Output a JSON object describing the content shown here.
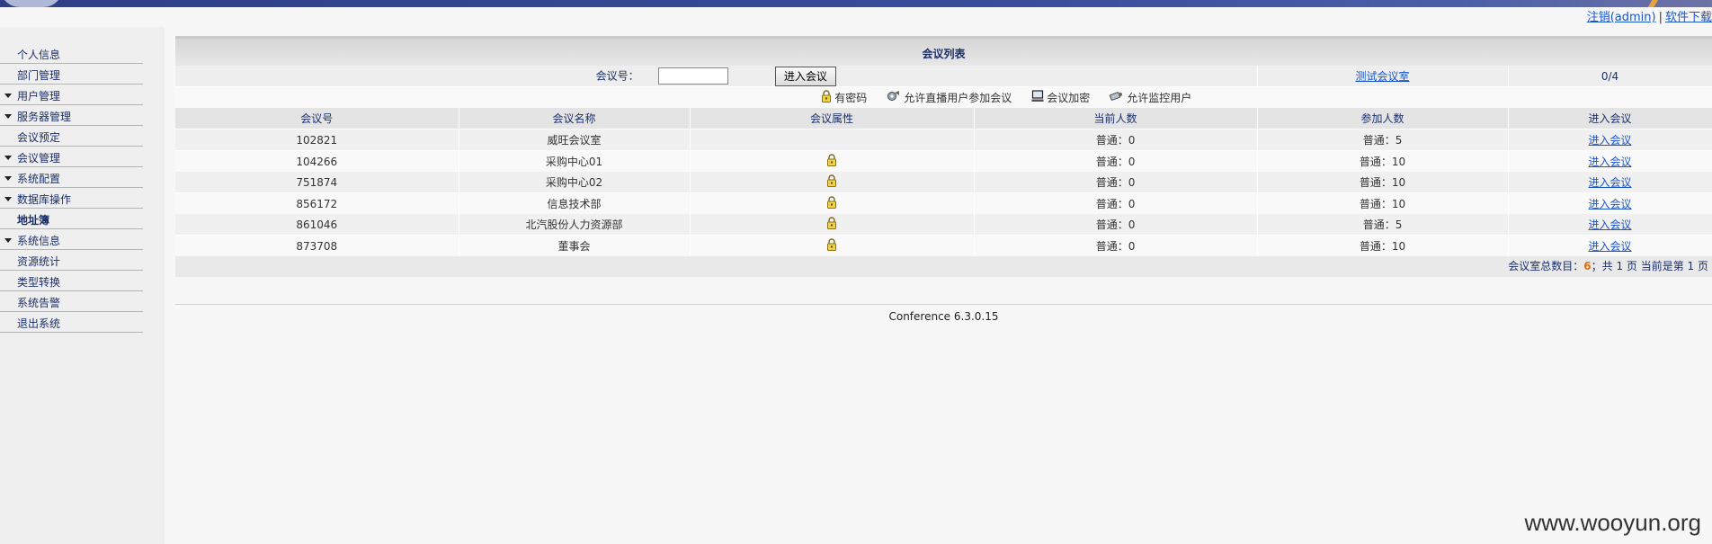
{
  "topbar": {
    "logout_label": "注销(admin)",
    "separator": "|",
    "download_label": "软件下载"
  },
  "sidebar": {
    "items": [
      {
        "label": "个人信息",
        "expandable": false
      },
      {
        "label": "部门管理",
        "expandable": false
      },
      {
        "label": "用户管理",
        "expandable": true
      },
      {
        "label": "服务器管理",
        "expandable": true
      },
      {
        "label": "会议预定",
        "expandable": false
      },
      {
        "label": "会议管理",
        "expandable": true
      },
      {
        "label": "系统配置",
        "expandable": true
      },
      {
        "label": "数据库操作",
        "expandable": true
      },
      {
        "label": "地址簿",
        "expandable": false
      },
      {
        "label": "系统信息",
        "expandable": true
      },
      {
        "label": "资源统计",
        "expandable": false
      },
      {
        "label": "类型转换",
        "expandable": false
      },
      {
        "label": "系统告警",
        "expandable": false
      },
      {
        "label": "退出系统",
        "expandable": false
      }
    ]
  },
  "main": {
    "title": "会议列表",
    "search": {
      "label": "会议号：",
      "value": "",
      "button": "进入会议",
      "test_room_link": "测试会议室",
      "online_count": "0/4"
    },
    "legend": [
      {
        "icon": "lock-icon",
        "label": "有密码"
      },
      {
        "icon": "broadcast-icon",
        "label": "允许直播用户参加会议"
      },
      {
        "icon": "computer-icon",
        "label": "会议加密"
      },
      {
        "icon": "monitor-camera-icon",
        "label": "允许监控用户"
      }
    ],
    "columns": [
      "会议号",
      "会议名称",
      "会议属性",
      "当前人数",
      "参加人数",
      "进入会议"
    ],
    "rows": [
      {
        "id": "102821",
        "name": "威旺会议室",
        "locked": false,
        "current": "普通：0",
        "capacity": "普通：5",
        "enter": "进入会议"
      },
      {
        "id": "104266",
        "name": "采购中心01",
        "locked": true,
        "current": "普通：0",
        "capacity": "普通：10",
        "enter": "进入会议"
      },
      {
        "id": "751874",
        "name": "采购中心02",
        "locked": true,
        "current": "普通：0",
        "capacity": "普通：10",
        "enter": "进入会议"
      },
      {
        "id": "856172",
        "name": "信息技术部",
        "locked": true,
        "current": "普通：0",
        "capacity": "普通：10",
        "enter": "进入会议"
      },
      {
        "id": "861046",
        "name": "北汽股份人力资源部",
        "locked": true,
        "current": "普通：0",
        "capacity": "普通：5",
        "enter": "进入会议"
      },
      {
        "id": "873708",
        "name": "董事会",
        "locked": true,
        "current": "普通：0",
        "capacity": "普通：10",
        "enter": "进入会议"
      }
    ],
    "footer": {
      "total_prefix": "会议室总数目：",
      "total": "6",
      "page_info": "；共 1 页 当前是第 1 页"
    },
    "version": "Conference 6.3.0.15"
  },
  "watermark": "www.wooyun.org",
  "colors": {
    "banner": "#2e3f86",
    "link": "#1a55c8",
    "menu_text": "#1b2f6a",
    "count_highlight": "#e06d10"
  }
}
